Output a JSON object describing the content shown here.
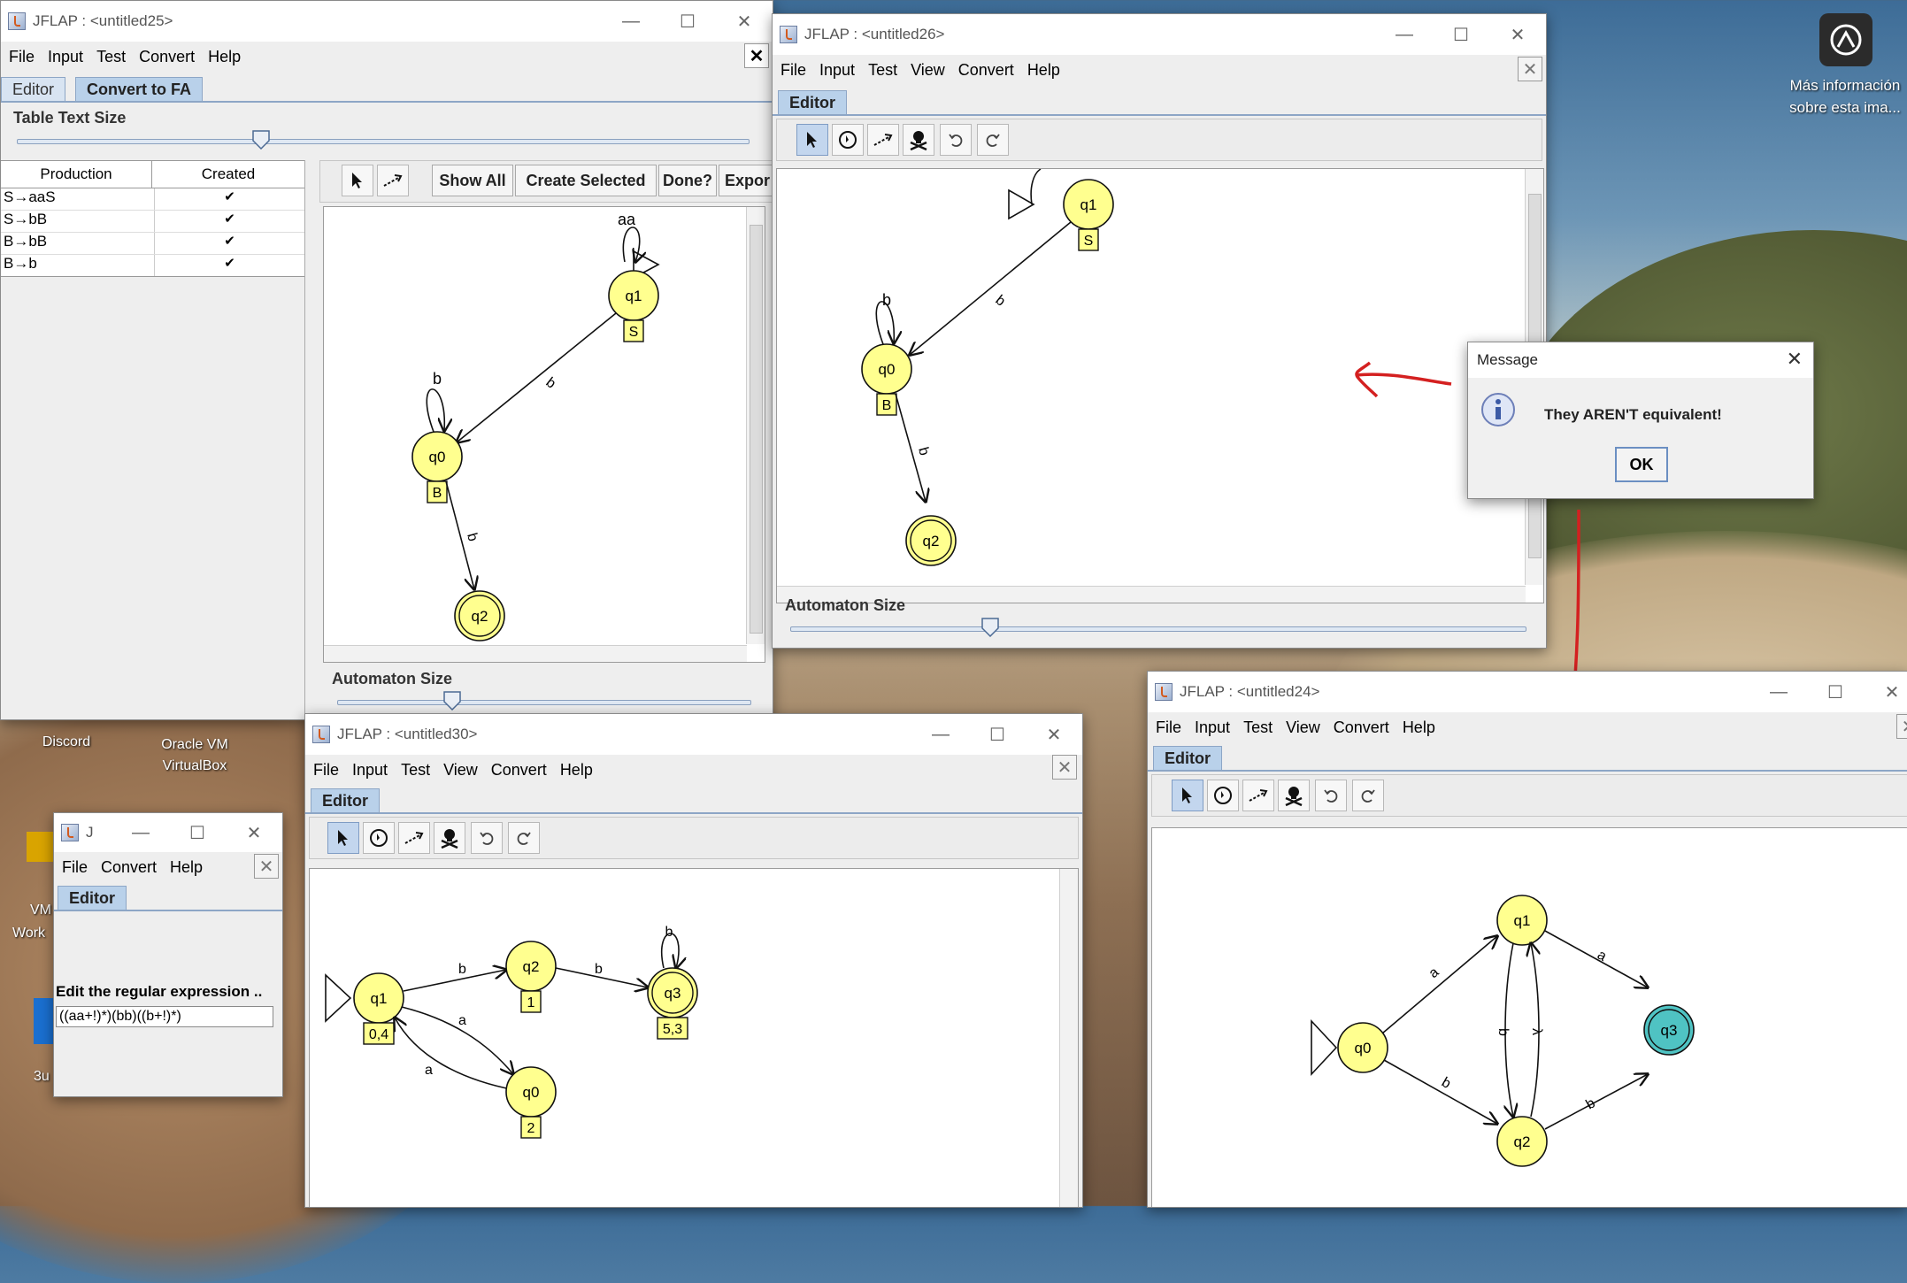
{
  "desktop": {
    "info_caption_line1": "Más información",
    "info_caption_line2": "sobre esta ima...",
    "icons": [
      {
        "label": "Discord"
      },
      {
        "label_line1": "Oracle VM",
        "label_line2": "VirtualBox"
      },
      {
        "label": "VM"
      },
      {
        "label": "Work"
      },
      {
        "label": "3u"
      }
    ]
  },
  "win25": {
    "title": "JFLAP : <untitled25>",
    "menu": [
      "File",
      "Input",
      "Test",
      "Convert",
      "Help"
    ],
    "tabs": [
      "Editor",
      "Convert to FA"
    ],
    "table_text_size_label": "Table Text Size",
    "table": {
      "headers": [
        "Production",
        "Created"
      ],
      "rows": [
        {
          "production": "S→aaS",
          "created": "✔"
        },
        {
          "production": "S→bB",
          "created": "✔"
        },
        {
          "production": "B→bB",
          "created": "✔"
        },
        {
          "production": "B→b",
          "created": "✔"
        }
      ]
    },
    "buttons": {
      "show_all": "Show All",
      "create_selected": "Create Selected",
      "done": "Done?",
      "export": "Expor"
    },
    "automaton_size_label": "Automaton Size",
    "states": [
      "q1",
      "q0",
      "q2"
    ],
    "state_labels": [
      "S",
      "B"
    ],
    "transitions": [
      "aa",
      "b",
      "b",
      "b"
    ]
  },
  "win26": {
    "title": "JFLAP : <untitled26>",
    "menu": [
      "File",
      "Input",
      "Test",
      "View",
      "Convert",
      "Help"
    ],
    "tabs": [
      "Editor"
    ],
    "automaton_size_label": "Automaton Size",
    "states": [
      "q1",
      "q0",
      "q2"
    ],
    "state_labels": [
      "S",
      "B"
    ],
    "transitions": [
      "b",
      "b",
      "b"
    ]
  },
  "message": {
    "title": "Message",
    "text": "They AREN'T equivalent!",
    "ok": "OK"
  },
  "win30": {
    "title": "JFLAP : <untitled30>",
    "menu": [
      "File",
      "Input",
      "Test",
      "View",
      "Convert",
      "Help"
    ],
    "tabs": [
      "Editor"
    ],
    "states": [
      "q1",
      "q2",
      "q3",
      "q0"
    ],
    "state_labels": [
      "0,4",
      "1",
      "5,3",
      "2"
    ],
    "transitions": [
      "b",
      "b",
      "b",
      "a",
      "a"
    ]
  },
  "winRE": {
    "title": "J",
    "menu": [
      "File",
      "Convert",
      "Help"
    ],
    "tabs": [
      "Editor"
    ],
    "prompt": "Edit the regular expression ..",
    "expression": "((aa+!)*)(bb)((b+!)*)"
  },
  "win24": {
    "title": "JFLAP : <untitled24>",
    "menu": [
      "File",
      "Input",
      "Test",
      "View",
      "Convert",
      "Help"
    ],
    "tabs": [
      "Editor"
    ],
    "states": [
      "q0",
      "q1",
      "q2",
      "q3"
    ],
    "transitions": [
      "a",
      "b",
      "b",
      "λ",
      "a",
      "b"
    ]
  },
  "colors": {
    "state_fill": "#ffff8f",
    "final_accent": "#4fc3c3",
    "arrow_red": "#d42020"
  }
}
